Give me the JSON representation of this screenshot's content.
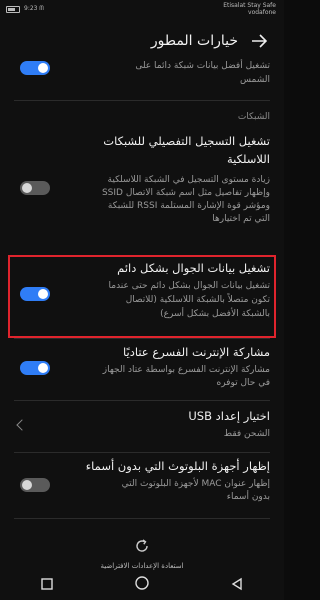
{
  "status_bar": {
    "left_text": "9:23 ᗰ",
    "carrier_line1": "Etisalat Stay Safe",
    "carrier_line2": "vodafone",
    "battery_icon": "battery-icon"
  },
  "header": {
    "title": "خيارات المطور",
    "back_icon": "arrow-back-icon"
  },
  "rows": {
    "top_partial": {
      "title_line1": "تشغيل أفضل بيانات شبكة دائما على",
      "title_line2": "الشمس",
      "toggle": "on"
    },
    "section_networks": "الشبكات",
    "wireless_logging": {
      "title_line1": "تشغيل التسجيل التفصيلي للشبكات",
      "title_line2": "اللاسلكية",
      "desc_line1": "زيادة مستوى التسجيل في الشبكة اللاسلكية",
      "desc_line2": "وإظهار تفاصيل مثل اسم شبكة الاتصال SSID",
      "desc_line3": "ومؤشر قوة الإشارة المستلمة RSSI للشبكة",
      "desc_line4": "التي تم اختيارها",
      "toggle": "off"
    },
    "mobile_data_always": {
      "title": "تشغيل بيانات الجوال بشكل دائم",
      "desc_line1": "تشغيل بيانات الجوال بشكل دائم حتى عندما",
      "desc_line2": "تكون متصلاً بالشبكة اللاسلكية (للاتصال",
      "desc_line3": "بالشبكة الأفضل بشكل أسرع)",
      "toggle": "on"
    },
    "tethering": {
      "title": "مشاركة الإنترنت الفسرع عتاديًا",
      "desc_line1": "مشاركة الإنترنت الفسرع بواسطة عتاد الجهاز",
      "desc_line2": "في حال توفره",
      "toggle": "on"
    },
    "usb_config": {
      "title": "اختيار إعداد USB",
      "desc": "الشحن فقط"
    },
    "bluetooth_nameless": {
      "title": "إظهار أجهزة البلوتوث التي بدون أسماء",
      "desc_line1": "إظهار عنوان MAC لأجهزة البلوتوث التي",
      "desc_line2": "بدون أسماء",
      "toggle": "off"
    }
  },
  "bottom": {
    "restore_label": "استعادة الإعدادات الافتراضية",
    "restore_icon": "refresh-icon"
  },
  "navbar": {
    "square_icon": "recents-square-icon",
    "home_icon": "home-circle-icon",
    "back_icon": "back-triangle-icon"
  },
  "colors": {
    "accent": "#2f7df6",
    "highlight_border": "#e0242d",
    "background": "#101010"
  }
}
